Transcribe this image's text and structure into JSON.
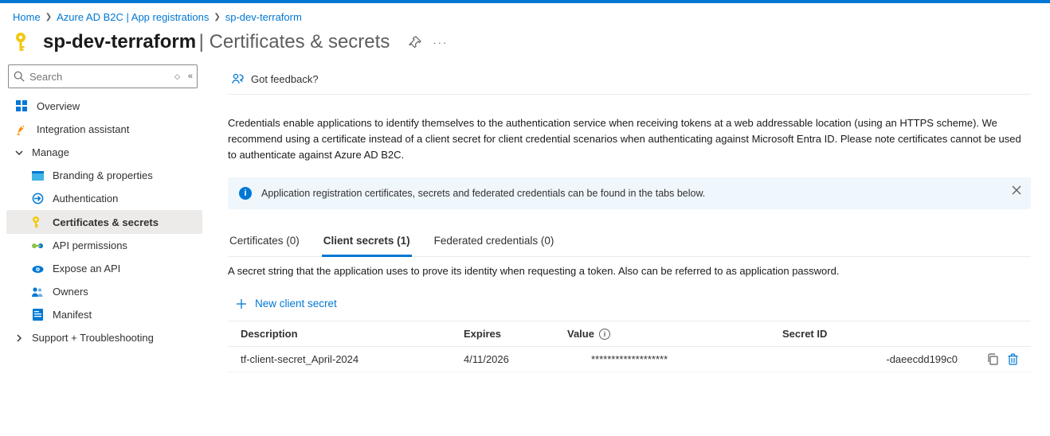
{
  "breadcrumb": {
    "home": "Home",
    "b2c": "Azure AD B2C | App registrations",
    "app": "sp-dev-terraform"
  },
  "title": {
    "app_name": "sp-dev-terraform",
    "section": "Certificates & secrets"
  },
  "search": {
    "placeholder": "Search"
  },
  "sidebar": {
    "overview": "Overview",
    "integration": "Integration assistant",
    "manage": "Manage",
    "branding": "Branding & properties",
    "authentication": "Authentication",
    "certs": "Certificates & secrets",
    "api_perms": "API permissions",
    "expose": "Expose an API",
    "owners": "Owners",
    "manifest": "Manifest",
    "support": "Support + Troubleshooting"
  },
  "toolbar": {
    "feedback": "Got feedback?"
  },
  "intro_text": "Credentials enable applications to identify themselves to the authentication service when receiving tokens at a web addressable location (using an HTTPS scheme). We recommend using a certificate instead of a client secret for client credential scenarios when authenticating against Microsoft Entra ID. Please note certificates cannot be used to authenticate against Azure AD B2C.",
  "banner": {
    "text": "Application registration certificates, secrets and federated credentials can be found in the tabs below."
  },
  "tabs": {
    "certificates": "Certificates (0)",
    "client_secrets": "Client secrets (1)",
    "federated": "Federated credentials (0)"
  },
  "tab_desc": "A secret string that the application uses to prove its identity when requesting a token. Also can be referred to as application password.",
  "new_secret": "New client secret",
  "table": {
    "headers": {
      "description": "Description",
      "expires": "Expires",
      "value": "Value",
      "secret_id": "Secret ID"
    },
    "row1": {
      "description": "tf-client-secret_April-2024",
      "expires": "4/11/2026",
      "value": "*******************",
      "secret_id_tail": "-daeecdd199c0"
    }
  }
}
